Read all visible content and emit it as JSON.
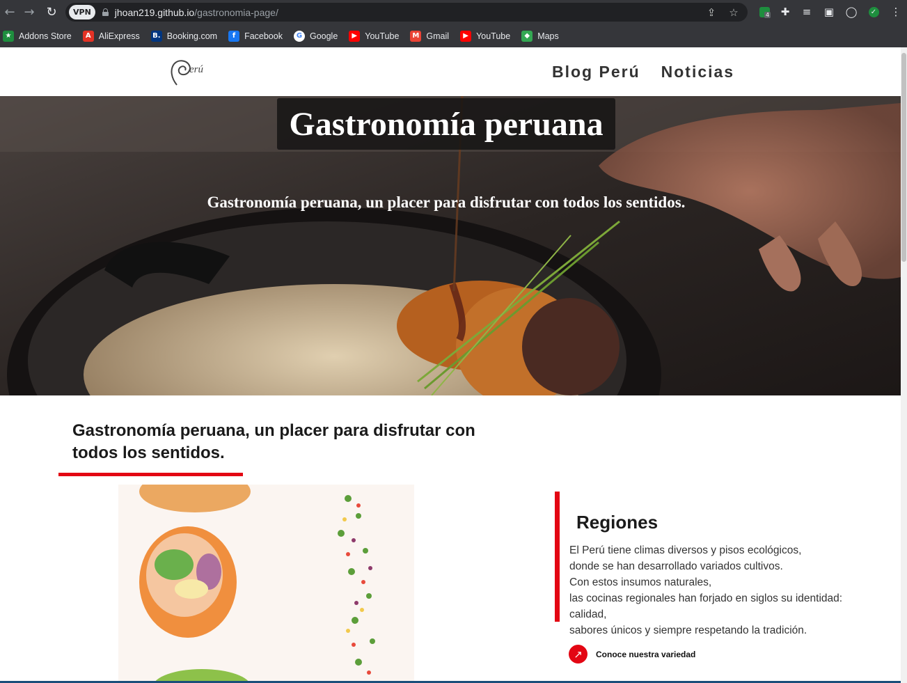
{
  "browser": {
    "vpn_badge": "VPN",
    "url_domain": "jhoan219.github.io",
    "url_path": "/gastronomia-page/",
    "extension_badge_count": "4",
    "bookmarks": [
      {
        "label": "Addons Store",
        "icon": "addons-store-icon",
        "color": "#1e8e3e",
        "glyph": "★"
      },
      {
        "label": "AliExpress",
        "icon": "aliexpress-icon",
        "color": "#e43225",
        "glyph": "A"
      },
      {
        "label": "Booking.com",
        "icon": "booking-icon",
        "color": "#003580",
        "glyph": "B."
      },
      {
        "label": "Facebook",
        "icon": "facebook-icon",
        "color": "#1877f2",
        "glyph": "f"
      },
      {
        "label": "Google",
        "icon": "google-icon",
        "color": "#ffffff",
        "glyph": "G"
      },
      {
        "label": "YouTube",
        "icon": "youtube-icon",
        "color": "#ff0000",
        "glyph": "▶"
      },
      {
        "label": "Gmail",
        "icon": "gmail-icon",
        "color": "#ea4335",
        "glyph": "M"
      },
      {
        "label": "YouTube",
        "icon": "youtube-icon",
        "color": "#ff0000",
        "glyph": "▶"
      },
      {
        "label": "Maps",
        "icon": "maps-icon",
        "color": "#34a853",
        "glyph": "◆"
      }
    ]
  },
  "site": {
    "logo_text": "erú",
    "nav": [
      "Blog Perú",
      "Noticias"
    ],
    "hero": {
      "title": "Gastronomía peruana",
      "subtitle": "Gastronomía peruana, un placer para disfrutar con todos los sentidos."
    },
    "intro_heading": "Gastronomía peruana, un placer para disfrutar con todos los sentidos.",
    "regions": {
      "title": "Regiones",
      "lines": [
        "El Perú tiene climas diversos y pisos ecológicos,",
        "donde se han desarrollado variados cultivos.",
        "Con estos insumos naturales,",
        "las cocinas regionales han forjado en siglos su identidad:",
        "calidad,",
        "sabores únicos y siempre respetando la tradición."
      ],
      "cta_label": "Conoce nuestra variedad"
    }
  },
  "colors": {
    "accent_red": "#e30613",
    "chrome_bg": "#35363a"
  }
}
